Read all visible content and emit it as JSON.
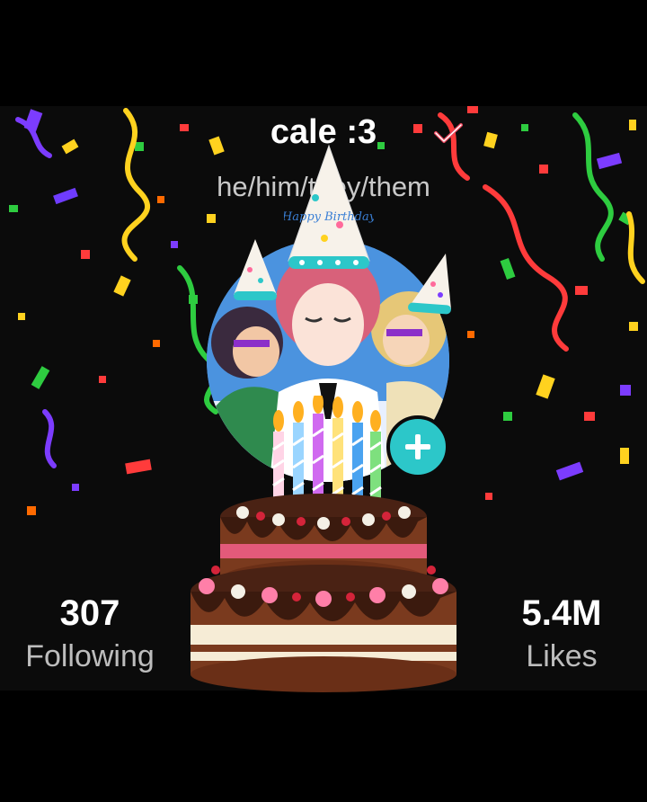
{
  "profile": {
    "username": "cale :3",
    "pronouns": "he/him/they/them"
  },
  "stats": {
    "following_count": "307",
    "following_label": "Following",
    "likes_count": "5.4M",
    "likes_label": "Likes"
  },
  "hat_text": "Happy Birthday",
  "colors": {
    "accent": "#2cc7c9",
    "verified": "#e8455c",
    "background": "#0b0b0b"
  },
  "icons": [
    "verified-check-icon",
    "plus-icon"
  ]
}
